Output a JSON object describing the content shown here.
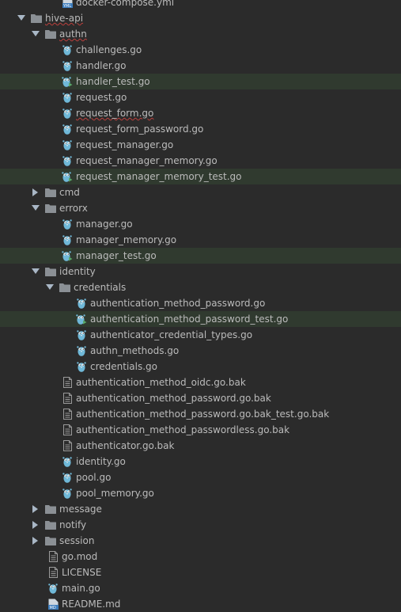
{
  "colors": {
    "background": "#2b2b2b",
    "text": "#bbbbbb",
    "test_row_highlight": "#303a2f",
    "folder": "#8b9095",
    "gopher": "#6fb8d8",
    "error_underline": "#bc3f3c"
  },
  "tree": [
    {
      "depth": 2,
      "type": "yaml",
      "label": "docker-compose.yml",
      "icon": "yaml-file-icon"
    },
    {
      "depth": 0,
      "type": "folder",
      "expanded": true,
      "label": "hive-api",
      "icon": "folder-icon",
      "error": true
    },
    {
      "depth": 1,
      "type": "folder",
      "expanded": true,
      "label": "authn",
      "icon": "folder-icon",
      "error": true
    },
    {
      "depth": 2,
      "type": "go",
      "label": "challenges.go",
      "icon": "go-file-icon"
    },
    {
      "depth": 2,
      "type": "go",
      "label": "handler.go",
      "icon": "go-file-icon"
    },
    {
      "depth": 2,
      "type": "gotest",
      "label": "handler_test.go",
      "icon": "go-test-file-icon"
    },
    {
      "depth": 2,
      "type": "go",
      "label": "request.go",
      "icon": "go-file-icon"
    },
    {
      "depth": 2,
      "type": "go",
      "label": "request_form.go",
      "icon": "go-file-icon",
      "error": true
    },
    {
      "depth": 2,
      "type": "go",
      "label": "request_form_password.go",
      "icon": "go-file-icon"
    },
    {
      "depth": 2,
      "type": "go",
      "label": "request_manager.go",
      "icon": "go-file-icon"
    },
    {
      "depth": 2,
      "type": "go",
      "label": "request_manager_memory.go",
      "icon": "go-file-icon"
    },
    {
      "depth": 2,
      "type": "gotest",
      "label": "request_manager_memory_test.go",
      "icon": "go-test-file-icon"
    },
    {
      "depth": 1,
      "type": "folder",
      "expanded": false,
      "label": "cmd",
      "icon": "folder-icon"
    },
    {
      "depth": 1,
      "type": "folder",
      "expanded": true,
      "label": "errorx",
      "icon": "folder-icon"
    },
    {
      "depth": 2,
      "type": "go",
      "label": "manager.go",
      "icon": "go-file-icon"
    },
    {
      "depth": 2,
      "type": "go",
      "label": "manager_memory.go",
      "icon": "go-file-icon"
    },
    {
      "depth": 2,
      "type": "gotest",
      "label": "manager_test.go",
      "icon": "go-test-file-icon"
    },
    {
      "depth": 1,
      "type": "folder",
      "expanded": true,
      "label": "identity",
      "icon": "folder-icon"
    },
    {
      "depth": 2,
      "type": "folder",
      "expanded": true,
      "label": "credentials",
      "icon": "folder-icon"
    },
    {
      "depth": 3,
      "type": "go",
      "label": "authentication_method_password.go",
      "icon": "go-file-icon"
    },
    {
      "depth": 3,
      "type": "gotest",
      "label": "authentication_method_password_test.go",
      "icon": "go-test-file-icon"
    },
    {
      "depth": 3,
      "type": "go",
      "label": "authenticator_credential_types.go",
      "icon": "go-file-icon"
    },
    {
      "depth": 3,
      "type": "go",
      "label": "authn_methods.go",
      "icon": "go-file-icon"
    },
    {
      "depth": 3,
      "type": "go",
      "label": "credentials.go",
      "icon": "go-file-icon"
    },
    {
      "depth": 2,
      "type": "text",
      "label": "authentication_method_oidc.go.bak",
      "icon": "text-file-icon"
    },
    {
      "depth": 2,
      "type": "text",
      "label": "authentication_method_password.go.bak",
      "icon": "text-file-icon"
    },
    {
      "depth": 2,
      "type": "text",
      "label": "authentication_method_password.go.bak_test.go.bak",
      "icon": "text-file-icon"
    },
    {
      "depth": 2,
      "type": "text",
      "label": "authentication_method_passwordless.go.bak",
      "icon": "text-file-icon"
    },
    {
      "depth": 2,
      "type": "text",
      "label": "authenticator.go.bak",
      "icon": "text-file-icon"
    },
    {
      "depth": 2,
      "type": "go",
      "label": "identity.go",
      "icon": "go-file-icon"
    },
    {
      "depth": 2,
      "type": "go",
      "label": "pool.go",
      "icon": "go-file-icon"
    },
    {
      "depth": 2,
      "type": "go",
      "label": "pool_memory.go",
      "icon": "go-file-icon"
    },
    {
      "depth": 1,
      "type": "folder",
      "expanded": false,
      "label": "message",
      "icon": "folder-icon"
    },
    {
      "depth": 1,
      "type": "folder",
      "expanded": false,
      "label": "notify",
      "icon": "folder-icon"
    },
    {
      "depth": 1,
      "type": "folder",
      "expanded": false,
      "label": "session",
      "icon": "folder-icon"
    },
    {
      "depth": 1,
      "type": "text",
      "label": "go.mod",
      "icon": "text-file-icon"
    },
    {
      "depth": 1,
      "type": "text",
      "label": "LICENSE",
      "icon": "text-file-icon"
    },
    {
      "depth": 1,
      "type": "go",
      "label": "main.go",
      "icon": "go-file-icon"
    },
    {
      "depth": 1,
      "type": "md",
      "label": "README.md",
      "icon": "markdown-file-icon"
    }
  ]
}
